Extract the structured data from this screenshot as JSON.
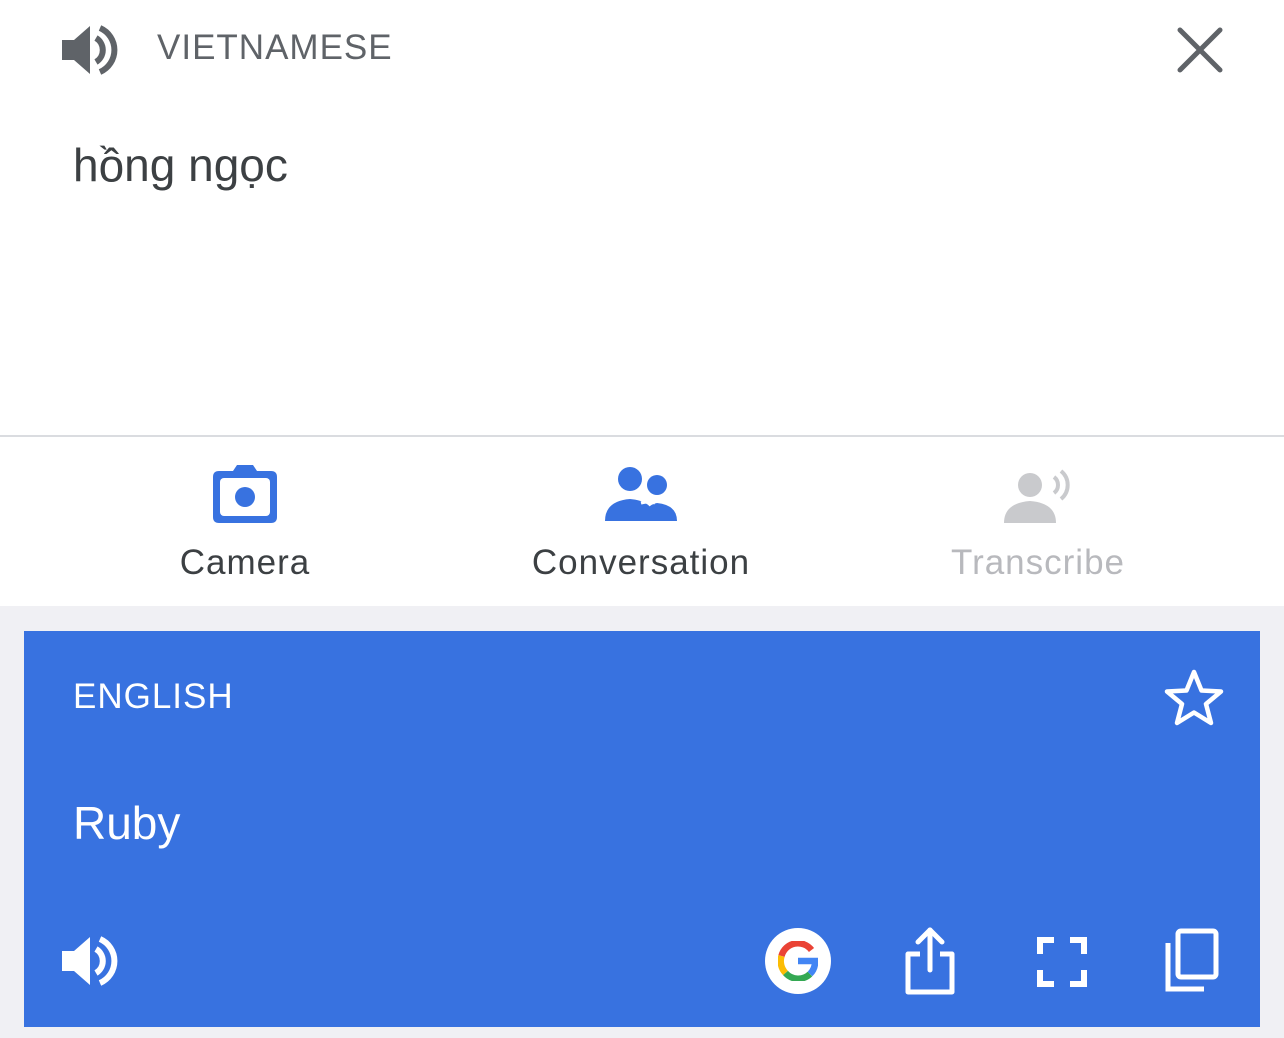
{
  "source": {
    "language": "VIETNAMESE",
    "text": "hồng ngọc",
    "speaker_icon": "speaker-icon",
    "close_icon": "close-icon"
  },
  "tools": [
    {
      "label": "Camera",
      "icon": "camera-icon",
      "enabled": true
    },
    {
      "label": "Conversation",
      "icon": "conversation-icon",
      "enabled": true
    },
    {
      "label": "Transcribe",
      "icon": "transcribe-icon",
      "enabled": false
    }
  ],
  "result": {
    "language": "ENGLISH",
    "text": "Ruby",
    "actions": [
      "speaker-icon",
      "google-icon",
      "share-icon",
      "fullscreen-icon",
      "copy-icon"
    ],
    "star_icon": "star-icon"
  },
  "colors": {
    "accent": "#3872e0",
    "text_dark": "#3c4043",
    "muted": "#5f6368",
    "disabled": "#b8b9bd"
  }
}
